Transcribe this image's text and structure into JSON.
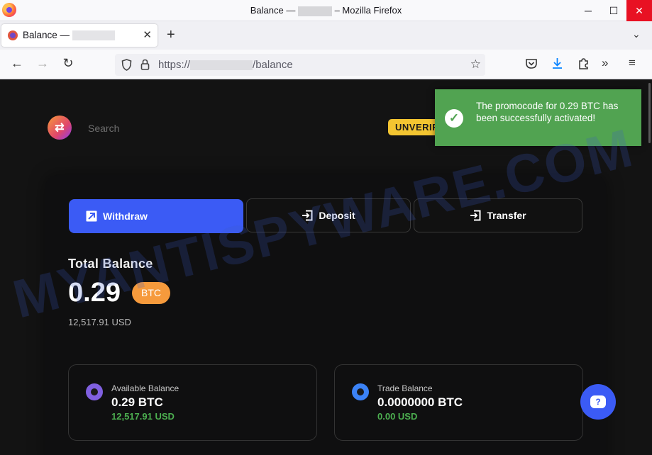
{
  "window": {
    "title_prefix": "Balance —",
    "title_suffix": "– Mozilla Firefox",
    "minimize": "─",
    "maximize": "☐",
    "close": "✕"
  },
  "tab": {
    "title": "Balance —",
    "close": "✕"
  },
  "tabstrip": {
    "new_tab": "+",
    "list_all": "⌄"
  },
  "nav": {
    "back": "←",
    "forward": "→",
    "reload": "↻"
  },
  "url": {
    "scheme": "https://",
    "path": "/balance"
  },
  "icons": {
    "shield": "shield-icon",
    "lock": "lock-icon",
    "star": "star-icon",
    "pocket": "pocket-icon",
    "download": "download-icon",
    "extensions": "puzzle-icon",
    "overflow": "chevron-double-right-icon",
    "menu": "hamburger-menu-icon"
  },
  "site": {
    "logo": "⇄",
    "search_placeholder": "Search",
    "unverified": "UNVERIFI"
  },
  "actions": {
    "withdraw": "Withdraw",
    "deposit": "Deposit",
    "transfer": "Transfer"
  },
  "balance": {
    "label": "Total Balance",
    "value": "0.29",
    "currency": "BTC",
    "usd": "12,517.91 USD"
  },
  "cards": {
    "available": {
      "label": "Available Balance",
      "value": "0.29 BTC",
      "usd": "12,517.91 USD"
    },
    "trade": {
      "label": "Trade Balance",
      "value": "0.0000000 BTC",
      "usd": "0.00 USD"
    }
  },
  "toast": {
    "message": "The promocode for 0.29 BTC has been successfully activated!"
  },
  "watermark": "MYANTISPYWARE.COM",
  "colors": {
    "accent": "#3b5bf5",
    "btc_badge": "#f69a3c",
    "success": "#51a351",
    "usd_green": "#4caf50",
    "unverified": "#f3c531"
  }
}
